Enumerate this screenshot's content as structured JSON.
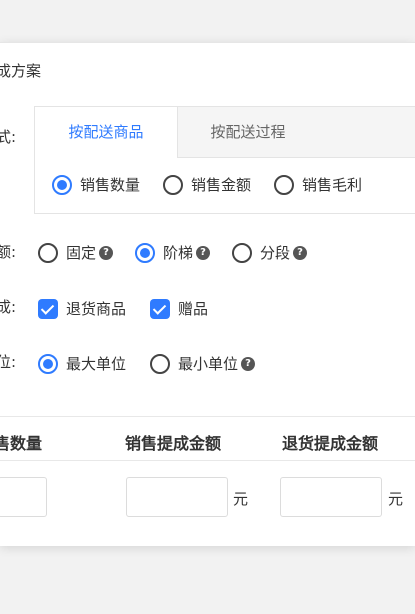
{
  "section_title": "成方案",
  "mode_label": "式:",
  "tabs": [
    {
      "label": "按配送商品",
      "active": true
    },
    {
      "label": "按配送过程",
      "active": false
    }
  ],
  "basis_options": [
    {
      "label": "销售数量",
      "checked": true
    },
    {
      "label": "销售金额",
      "checked": false
    },
    {
      "label": "销售毛利",
      "checked": false
    }
  ],
  "amount_label": "额:",
  "amount_options": [
    {
      "label": "固定",
      "checked": false,
      "help": true
    },
    {
      "label": "阶梯",
      "checked": true,
      "help": true
    },
    {
      "label": "分段",
      "checked": false,
      "help": true
    }
  ],
  "include_label": "成:",
  "include_options": [
    {
      "label": "退货商品",
      "checked": true
    },
    {
      "label": "赠品",
      "checked": true
    }
  ],
  "unit_label": "位:",
  "unit_options": [
    {
      "label": "最大单位",
      "checked": true
    },
    {
      "label": "最小单位",
      "checked": false,
      "help": true
    }
  ],
  "help_glyph": "?",
  "table": {
    "headers": [
      "售数量",
      "销售提成金额",
      "退货提成金额"
    ],
    "unit_suffix": "元"
  },
  "colors": {
    "accent": "#2f7bff"
  }
}
